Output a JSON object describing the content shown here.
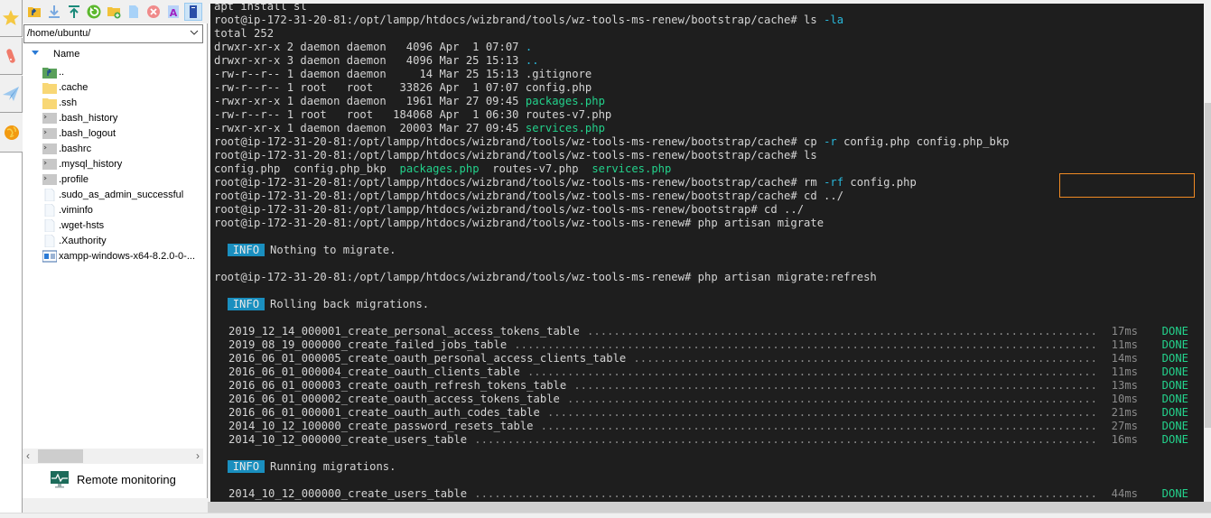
{
  "toolbar": {
    "buttons": [
      {
        "icon": "parent-folder-icon"
      },
      {
        "icon": "download-icon"
      },
      {
        "icon": "upload-icon"
      },
      {
        "icon": "refresh-icon"
      },
      {
        "icon": "new-folder-icon"
      },
      {
        "icon": "new-file-icon"
      },
      {
        "icon": "delete-icon"
      },
      {
        "icon": "rename-icon"
      },
      {
        "icon": "properties-icon"
      }
    ]
  },
  "path": {
    "value": "/home/ubuntu/"
  },
  "file_list": {
    "column_header": "Name",
    "items": [
      {
        "name": "..",
        "type": "parent"
      },
      {
        "name": ".cache",
        "type": "folder"
      },
      {
        "name": ".ssh",
        "type": "folder"
      },
      {
        "name": ".bash_history",
        "type": "terminal-file"
      },
      {
        "name": ".bash_logout",
        "type": "terminal-file"
      },
      {
        "name": ".bashrc",
        "type": "terminal-file"
      },
      {
        "name": ".mysql_history",
        "type": "terminal-file"
      },
      {
        "name": ".profile",
        "type": "terminal-file"
      },
      {
        "name": ".sudo_as_admin_successful",
        "type": "file"
      },
      {
        "name": ".viminfo",
        "type": "file"
      },
      {
        "name": ".wget-hsts",
        "type": "file"
      },
      {
        "name": ".Xauthority",
        "type": "file"
      },
      {
        "name": "xampp-windows-x64-8.2.0-0-...",
        "type": "installer"
      }
    ]
  },
  "remote_monitoring": {
    "label": "Remote monitoring"
  },
  "terminal": {
    "prompt": "root@ip-172-31-20-81:/opt/lampp/htdocs/wizbrand/tools/wz-tools-ms-renew/bootstrap/cache# ",
    "prompt_bootstrap": "root@ip-172-31-20-81:/opt/lampp/htdocs/wizbrand/tools/wz-tools-ms-renew/bootstrap# ",
    "prompt_root": "root@ip-172-31-20-81:/opt/lampp/htdocs/wizbrand/tools/wz-tools-ms-renew# ",
    "line0": "apt install sl",
    "cmd_ls_la": "ls",
    "cmd_ls_la_flag": " -la",
    "total": "total 252",
    "ls_rows": [
      {
        "meta": "drwxr-xr-x 2 daemon daemon   4096 Apr  1 07:07 ",
        "name": ".",
        "color": "cyan"
      },
      {
        "meta": "drwxr-xr-x 3 daemon daemon   4096 Mar 25 15:13 ",
        "name": "..",
        "color": "cyan"
      },
      {
        "meta": "-rw-r--r-- 1 daemon daemon     14 Mar 25 15:13 ",
        "name": ".gitignore",
        "color": "plain"
      },
      {
        "meta": "-rw-r--r-- 1 root   root    33826 Apr  1 07:07 ",
        "name": "config.php",
        "color": "plain"
      },
      {
        "meta": "-rwxr-xr-x 1 daemon daemon   1961 Mar 27 09:45 ",
        "name": "packages.php",
        "color": "green"
      },
      {
        "meta": "-rw-r--r-- 1 root   root   184068 Apr  1 06:30 ",
        "name": "routes-v7.php",
        "color": "plain"
      },
      {
        "meta": "-rwxr-xr-x 1 daemon daemon  20003 Mar 27 09:45 ",
        "name": "services.php",
        "color": "green"
      }
    ],
    "cmd_cp": "cp",
    "cmd_cp_flag": " -r",
    "cmd_cp_args": " config.php config.php_bkp",
    "cmd_ls": "ls",
    "ls_short": [
      {
        "name": "config.php",
        "color": "plain"
      },
      {
        "name": "config.php_bkp",
        "color": "plain"
      },
      {
        "name": "packages.php",
        "color": "green"
      },
      {
        "name": "routes-v7.php",
        "color": "plain"
      },
      {
        "name": "services.php",
        "color": "green"
      }
    ],
    "cmd_rm": "rm",
    "cmd_rm_flag": " -rf",
    "cmd_rm_args": " config.php",
    "cmd_cd1": "cd ../",
    "cmd_cd2": "cd ../",
    "cmd_migrate": "php artisan migrate",
    "info_label": "INFO",
    "msg_nothing": "Nothing to migrate.",
    "cmd_refresh": "php artisan migrate:refresh",
    "msg_rolling": "Rolling back migrations.",
    "rollback": [
      {
        "name": "2019_12_14_000001_create_personal_access_tokens_table",
        "time": "17ms",
        "status": "DONE"
      },
      {
        "name": "2019_08_19_000000_create_failed_jobs_table",
        "time": "11ms",
        "status": "DONE"
      },
      {
        "name": "2016_06_01_000005_create_oauth_personal_access_clients_table",
        "time": "14ms",
        "status": "DONE"
      },
      {
        "name": "2016_06_01_000004_create_oauth_clients_table",
        "time": "11ms",
        "status": "DONE"
      },
      {
        "name": "2016_06_01_000003_create_oauth_refresh_tokens_table",
        "time": "13ms",
        "status": "DONE"
      },
      {
        "name": "2016_06_01_000002_create_oauth_access_tokens_table",
        "time": "10ms",
        "status": "DONE"
      },
      {
        "name": "2016_06_01_000001_create_oauth_auth_codes_table",
        "time": "21ms",
        "status": "DONE"
      },
      {
        "name": "2014_10_12_100000_create_password_resets_table",
        "time": "27ms",
        "status": "DONE"
      },
      {
        "name": "2014_10_12_000000_create_users_table",
        "time": "16ms",
        "status": "DONE"
      }
    ],
    "msg_running": "Running migrations.",
    "running": [
      {
        "name": "2014_10_12_000000_create_users_table",
        "time": "44ms",
        "status": "DONE"
      }
    ]
  },
  "colors": {
    "terminal_bg": "#1e1e1e",
    "terminal_fg": "#d4d4d4",
    "green": "#23d18b",
    "cyan": "#29b8db",
    "info_badge": "#1a8fbf",
    "highlight_border": "#f08a24"
  }
}
